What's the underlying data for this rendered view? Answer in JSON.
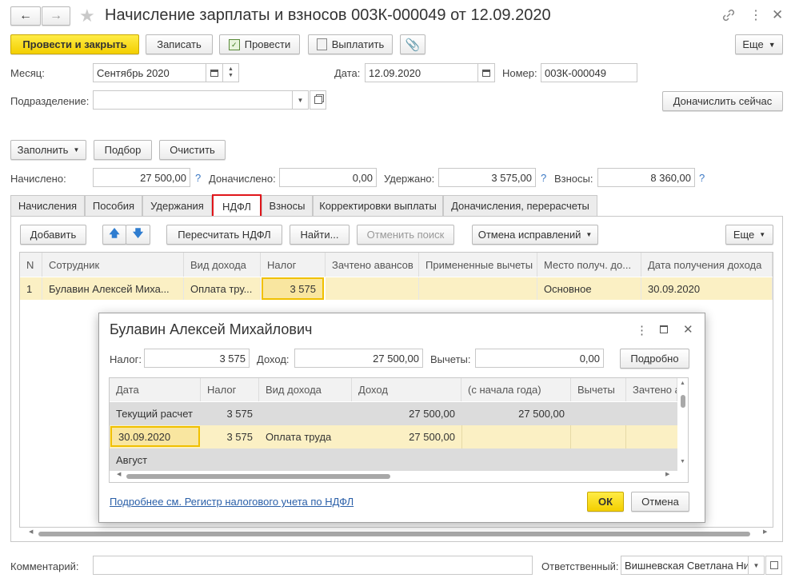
{
  "window": {
    "title": "Начисление зарплаты и взносов 003К-000049 от 12.09.2020"
  },
  "toolbar": {
    "post_close": "Провести и закрыть",
    "save": "Записать",
    "post": "Провести",
    "pay": "Выплатить",
    "more": "Еще"
  },
  "header": {
    "month_label": "Месяц:",
    "month_value": "Сентябрь 2020",
    "date_label": "Дата:",
    "date_value": "12.09.2020",
    "number_label": "Номер:",
    "number_value": "003К-000049",
    "dept_label": "Подразделение:",
    "dept_value": "",
    "accrue_now": "Доначислить сейчас"
  },
  "actions": {
    "fill": "Заполнить",
    "select": "Подбор",
    "clear": "Очистить"
  },
  "totals": {
    "accrued_label": "Начислено:",
    "accrued": "27 500,00",
    "extra_label": "Доначислено:",
    "extra": "0,00",
    "withheld_label": "Удержано:",
    "withheld": "3 575,00",
    "contrib_label": "Взносы:",
    "contrib": "8 360,00",
    "q": "?"
  },
  "tabs": [
    "Начисления",
    "Пособия",
    "Удержания",
    "НДФЛ",
    "Взносы",
    "Корректировки выплаты",
    "Доначисления, перерасчеты"
  ],
  "tabbar": {
    "add": "Добавить",
    "recalc": "Пересчитать НДФЛ",
    "find": "Найти...",
    "cancel_search": "Отменить поиск",
    "cancel_fix": "Отмена исправлений",
    "more": "Еще"
  },
  "table": {
    "headers": [
      "N",
      "Сотрудник",
      "Вид дохода",
      "Налог",
      "Зачтено авансов",
      "Примененные вычеты",
      "Место получ. до...",
      "Дата получения дохода"
    ],
    "row": [
      "1",
      "Булавин Алексей Миха...",
      "Оплата тру...",
      "3 575",
      "",
      "",
      "Основное",
      "30.09.2020"
    ]
  },
  "dialog": {
    "title": "Булавин Алексей Михайлович",
    "tax_label": "Налог:",
    "tax": "3 575",
    "income_label": "Доход:",
    "income": "27 500,00",
    "deduct_label": "Вычеты:",
    "deduct": "0,00",
    "details": "Подробно",
    "headers": [
      "Дата",
      "Налог",
      "Вид дохода",
      "Доход",
      "(с начала года)",
      "Вычеты",
      "Зачтено а"
    ],
    "rows": [
      [
        "Текущий расчет",
        "3 575",
        "",
        "27 500,00",
        "27 500,00",
        "",
        ""
      ],
      [
        "30.09.2020",
        "3 575",
        "Оплата труда",
        "27 500,00",
        "",
        "",
        ""
      ],
      [
        "Август",
        "",
        "",
        "",
        "",
        "",
        ""
      ]
    ],
    "link": "Подробнее см. Регистр налогового учета по НДФЛ",
    "ok": "ОК",
    "cancel": "Отмена"
  },
  "footer": {
    "comment_label": "Комментарий:",
    "comment": "",
    "resp_label": "Ответственный:",
    "resp_value": "Вишневская Светлана Ни"
  },
  "colors": {
    "accent_yellow": "#f5d400",
    "row_yellow": "#fbf0c4",
    "tab_highlight": "#e0161b",
    "link_blue": "#2a5fa8"
  }
}
